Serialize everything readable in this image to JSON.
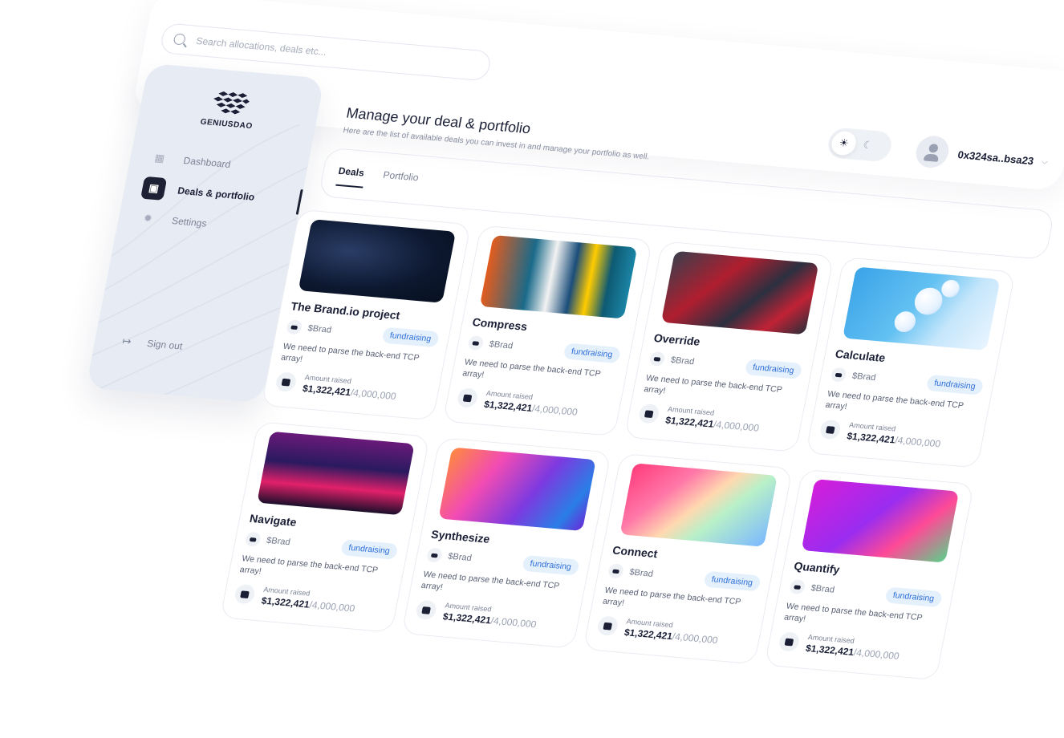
{
  "search": {
    "placeholder": "Search allocations, deals etc..."
  },
  "brand": {
    "name": "GENIUSDAO"
  },
  "sidebar": {
    "items": [
      {
        "label": "Dashboard",
        "icon": "dashboard-icon"
      },
      {
        "label": "Deals & portfolio",
        "icon": "briefcase-icon"
      },
      {
        "label": "Settings",
        "icon": "gear-icon"
      }
    ],
    "signout": "Sign out"
  },
  "header": {
    "title": "Manage your deal & portfolio",
    "subtitle": "Here are the list of available deals you can invest in and manage your portfolio as well."
  },
  "theme": {
    "light_icon": "☀",
    "dark_icon": "☾"
  },
  "user": {
    "wallet": "0x324sa..bsa23",
    "chevron": "⌵"
  },
  "tabs": [
    {
      "label": "Deals"
    },
    {
      "label": "Portfolio"
    }
  ],
  "cards": [
    {
      "name": "The Brand.io project",
      "token": "$Brad",
      "badge": "fundraising",
      "desc": "We need to parse the back-end TCP array!",
      "raised_label": "Amount raised",
      "raised": "$1,322,421",
      "target": "/4,000,000"
    },
    {
      "name": "Compress",
      "token": "$Brad",
      "badge": "fundraising",
      "desc": "We need to parse the back-end TCP array!",
      "raised_label": "Amount raised",
      "raised": "$1,322,421",
      "target": "/4,000,000"
    },
    {
      "name": "Override",
      "token": "$Brad",
      "badge": "fundraising",
      "desc": "We need to parse the back-end TCP array!",
      "raised_label": "Amount raised",
      "raised": "$1,322,421",
      "target": "/4,000,000"
    },
    {
      "name": "Calculate",
      "token": "$Brad",
      "badge": "fundraising",
      "desc": "We need to parse the back-end TCP array!",
      "raised_label": "Amount raised",
      "raised": "$1,322,421",
      "target": "/4,000,000"
    },
    {
      "name": "Navigate",
      "token": "$Brad",
      "badge": "fundraising",
      "desc": "We need to parse the back-end TCP array!",
      "raised_label": "Amount raised",
      "raised": "$1,322,421",
      "target": "/4,000,000"
    },
    {
      "name": "Synthesize",
      "token": "$Brad",
      "badge": "fundraising",
      "desc": "We need to parse the back-end TCP array!",
      "raised_label": "Amount raised",
      "raised": "$1,322,421",
      "target": "/4,000,000"
    },
    {
      "name": "Connect",
      "token": "$Brad",
      "badge": "fundraising",
      "desc": "We need to parse the back-end TCP array!",
      "raised_label": "Amount raised",
      "raised": "$1,322,421",
      "target": "/4,000,000"
    },
    {
      "name": "Quantify",
      "token": "$Brad",
      "badge": "fundraising",
      "desc": "We need to parse the back-end TCP array!",
      "raised_label": "Amount raised",
      "raised": "$1,322,421",
      "target": "/4,000,000"
    }
  ]
}
